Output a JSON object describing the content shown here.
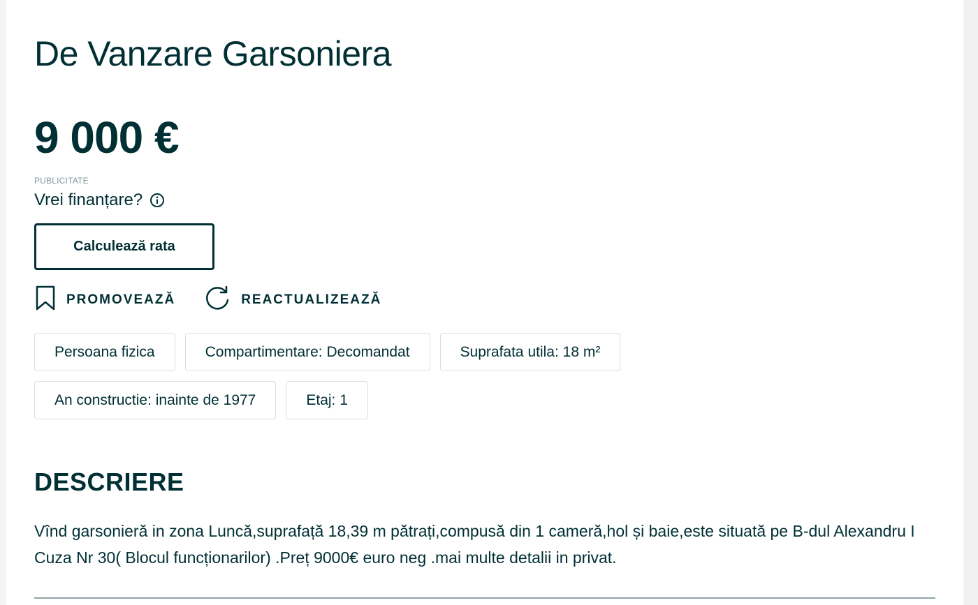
{
  "listing": {
    "title": "De Vanzare Garsoniera",
    "price": "9 000 €"
  },
  "financing": {
    "ad_label": "PUBLICITATE",
    "question": "Vrei finanțare?",
    "info_icon": "info-icon",
    "calc_button": "Calculează rata"
  },
  "actions": {
    "promote": {
      "label": "PROMOVEAZĂ",
      "icon": "bookmark-icon"
    },
    "refresh": {
      "label": "REACTUALIZEAZĂ",
      "icon": "refresh-icon"
    }
  },
  "tags": [
    "Persoana fizica",
    "Compartimentare: Decomandat",
    "Suprafata utila: 18 m²",
    "An constructie: inainte de 1977",
    "Etaj: 1"
  ],
  "description": {
    "heading": "DESCRIERE",
    "text": "Vînd garsonieră in zona Luncă,suprafață 18,39 m pătrați,compusă din 1 cameră,hol și baie,este situată pe B-dul Alexandru I Cuza Nr 30( Blocul funcționarilor) .Preț 9000€ euro neg .mai multe detalii in privat."
  },
  "colors": {
    "primary_text": "#002f34",
    "border": "#d8dfe0",
    "muted": "#7f9799"
  }
}
